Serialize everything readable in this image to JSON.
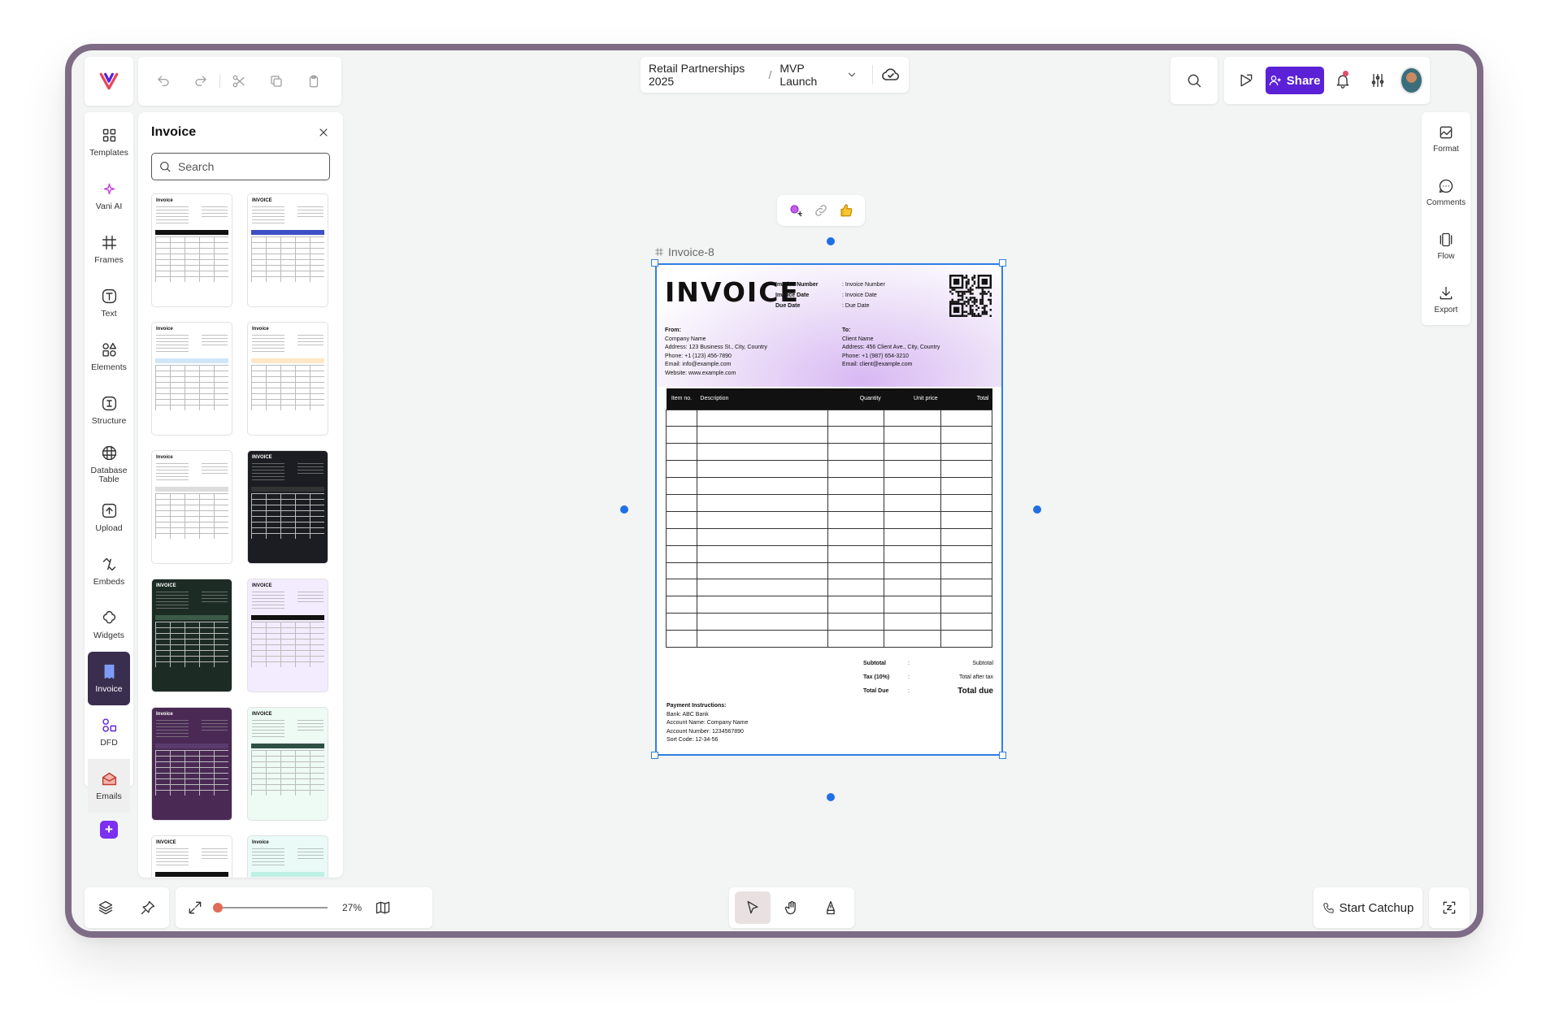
{
  "breadcrumb": {
    "project": "Retail Partnerships 2025",
    "separator": "/",
    "page": "MVP Launch"
  },
  "header": {
    "share_label": "Share"
  },
  "sidebar": {
    "items": [
      {
        "label": "Templates",
        "icon": "templates-icon"
      },
      {
        "label": "Vani AI",
        "icon": "sparkle-icon"
      },
      {
        "label": "Frames",
        "icon": "frame-icon"
      },
      {
        "label": "Text",
        "icon": "text-icon"
      },
      {
        "label": "Elements",
        "icon": "elements-icon"
      },
      {
        "label": "Structure",
        "icon": "structure-icon"
      },
      {
        "label": "Database Table",
        "icon": "database-table-icon"
      },
      {
        "label": "Upload",
        "icon": "upload-icon"
      },
      {
        "label": "Embeds",
        "icon": "embeds-icon"
      },
      {
        "label": "Widgets",
        "icon": "widgets-icon"
      },
      {
        "label": "Invoice",
        "icon": "invoice-icon"
      },
      {
        "label": "DFD",
        "icon": "dfd-icon"
      },
      {
        "label": "Emails",
        "icon": "email-icon"
      }
    ]
  },
  "panel": {
    "title": "Invoice",
    "search_placeholder": "Search",
    "thumbnails": [
      {
        "title": "Invoice",
        "accent": "#111111",
        "bg": "#ffffff"
      },
      {
        "title": "INVOICE",
        "accent": "#3c4fc4",
        "bg": "#ffffff"
      },
      {
        "title": "Invoice",
        "accent": "#cfe6f7",
        "bg": "#ffffff"
      },
      {
        "title": "Invoice",
        "accent": "#fde7c6",
        "bg": "#ffffff"
      },
      {
        "title": "Invoice",
        "accent": "#dddddd",
        "bg": "#ffffff"
      },
      {
        "title": "INVOICE",
        "accent": "#333333",
        "bg": "#1b1d22"
      },
      {
        "title": "INVOICE",
        "accent": "#3b5a48",
        "bg": "#1d2b25"
      },
      {
        "title": "INVOICE",
        "accent": "#111111",
        "bg": "#f3ecff"
      },
      {
        "title": "Invoice",
        "accent": "#5a3b6e",
        "bg": "#4a2a55"
      },
      {
        "title": "INVOICE",
        "accent": "#2f4f45",
        "bg": "#eefaf4"
      },
      {
        "title": "INVOICE",
        "accent": "#111111",
        "bg": "#ffffff"
      },
      {
        "title": "Invoice",
        "accent": "#bff0e4",
        "bg": "#eafaf6"
      }
    ]
  },
  "rail": {
    "items": [
      {
        "label": "Format",
        "icon": "format-icon"
      },
      {
        "label": "Comments",
        "icon": "comment-icon"
      },
      {
        "label": "Flow",
        "icon": "flow-icon"
      },
      {
        "label": "Export",
        "icon": "export-icon"
      }
    ]
  },
  "zoom": {
    "value_label": "27%",
    "fraction": 0.0
  },
  "catchup": {
    "label": "Start Catchup"
  },
  "canvas": {
    "frame_name": "Invoice-8",
    "invoice": {
      "title": "INVOICE",
      "meta_keys": [
        "Invoice Number",
        "Invoice Date",
        "Due Date"
      ],
      "meta_values": [
        ": Invoice Number",
        ": Invoice Date",
        ": Due Date"
      ],
      "from": {
        "heading": "From:",
        "lines": [
          "Company Name",
          "Address: 123 Business St., City, Country",
          "Phone: +1 (123) 456-7890",
          "Email: info@example.com",
          "Website: www.example.com"
        ]
      },
      "to": {
        "heading": "To:",
        "lines": [
          "Client Name",
          "Address: 456 Client Ave., City, Country",
          "Phone: +1 (987) 654-3210",
          "Email: client@example.com"
        ]
      },
      "columns": [
        "Item no.",
        "Description",
        "Quantity",
        "Unit price",
        "Total"
      ],
      "empty_rows": 14,
      "totals": [
        {
          "key": "Subtotal",
          "value": "Subtotal"
        },
        {
          "key": "Tax (10%)",
          "value": "Total after tax"
        },
        {
          "key": "Total Due",
          "value": "Total due"
        }
      ],
      "payment": {
        "heading": "Payment Instructions:",
        "lines": [
          "Bank: ABC Bank",
          "Account Name: Company Name",
          "Account Number: 1234567890",
          "Sort Code: 12-34-56"
        ]
      }
    }
  },
  "colors": {
    "accent": "#5b21d6",
    "selection": "#2f7fe0",
    "frame_border": "#7e6b85",
    "active_sidebar": "#3a2e4f"
  }
}
